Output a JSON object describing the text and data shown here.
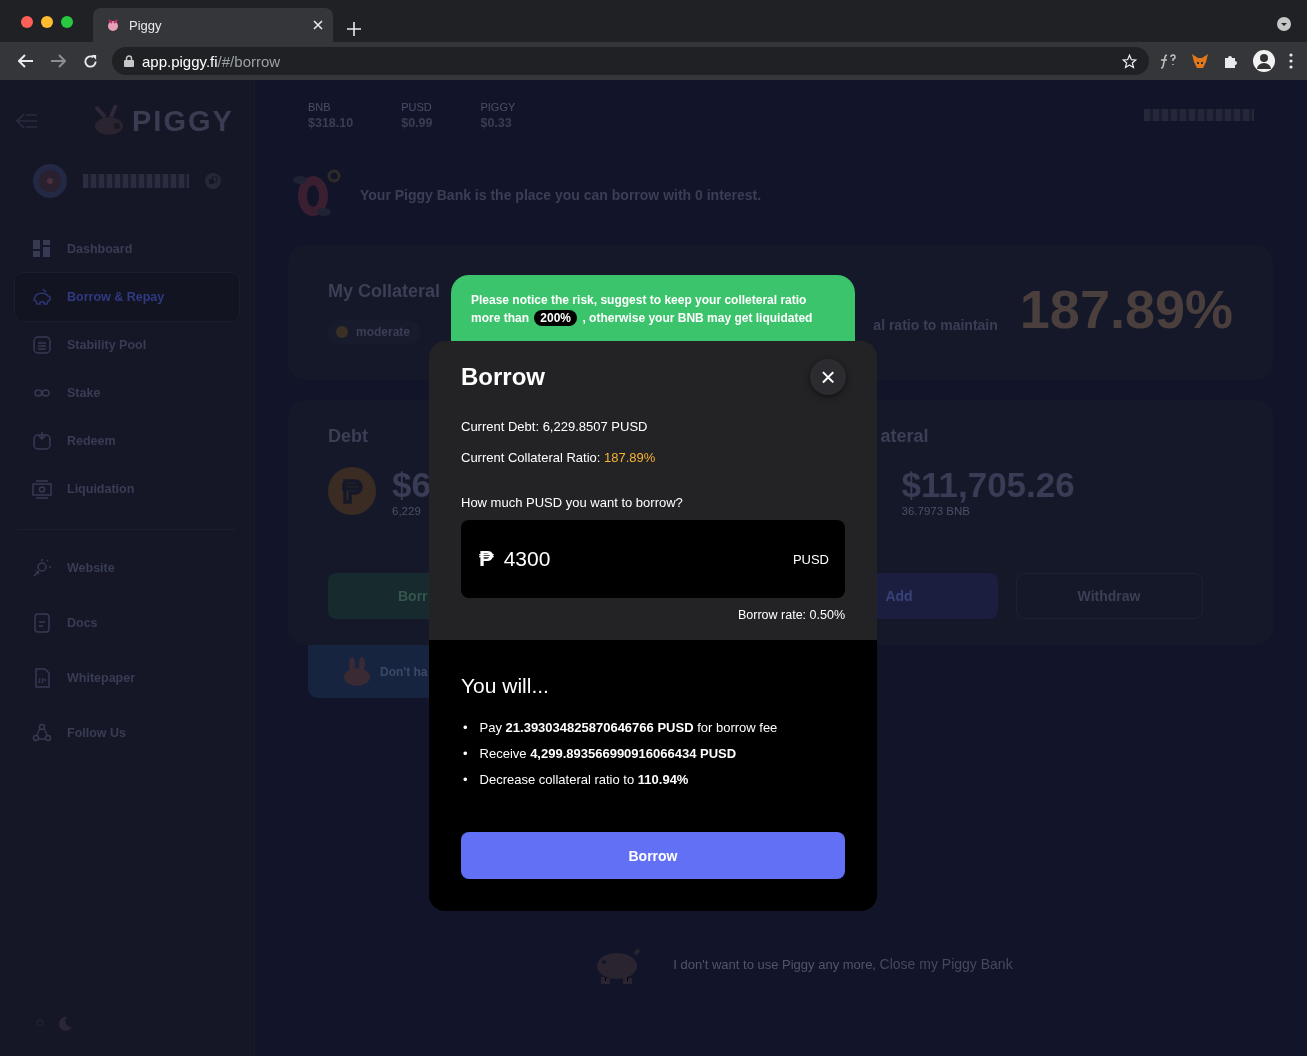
{
  "browser": {
    "tab_title": "Piggy",
    "url_host": "app.piggy.fi",
    "url_path": "/#/borrow"
  },
  "sidebar": {
    "logo": "PIGGY",
    "items": [
      {
        "label": "Dashboard",
        "selected": false,
        "kind": "dashboard"
      },
      {
        "label": "Borrow & Repay",
        "selected": true,
        "kind": "piggy"
      },
      {
        "label": "Stability Pool",
        "selected": false,
        "kind": "pool"
      },
      {
        "label": "Stake",
        "selected": false,
        "kind": "stake"
      },
      {
        "label": "Redeem",
        "selected": false,
        "kind": "redeem"
      },
      {
        "label": "Liquidation",
        "selected": false,
        "kind": "cash"
      }
    ],
    "links": [
      {
        "label": "Website",
        "selected": false,
        "kind": "web"
      },
      {
        "label": "Docs",
        "selected": false,
        "kind": "doc"
      },
      {
        "label": "Whitepaper",
        "selected": false,
        "kind": "paper"
      },
      {
        "label": "Follow Us",
        "selected": false,
        "kind": "follow"
      }
    ]
  },
  "prices": [
    {
      "symbol": "BNB",
      "price": "$318.10"
    },
    {
      "symbol": "PUSD",
      "price": "$0.99"
    },
    {
      "symbol": "PIGGY",
      "price": "$0.33"
    }
  ],
  "intro": "Your Piggy Bank is the place you can borrow with 0 interest.",
  "ratio_card": {
    "title": "My Collateral",
    "risk": "moderate",
    "note": "al ratio to maintain",
    "ratio": "187.89%"
  },
  "debt_card": {
    "title": "Debt",
    "amount": "$6",
    "sub": "6,229",
    "button": "Borr"
  },
  "collateral_card": {
    "title": "ateral",
    "amount": "$11,705.26",
    "sub": "36.7973 BNB",
    "buttons": [
      {
        "label": "Add",
        "kind": "primary"
      },
      {
        "label": "Withdraw",
        "kind": "outline"
      }
    ]
  },
  "promo": "Don't ha",
  "footer": {
    "text": "I don't want to use Piggy any more,",
    "link": "Close my Piggy Bank"
  },
  "modal": {
    "warning_before": "Please notice the risk, suggest to keep your colleteral ratio more than",
    "warning_badge": "200%",
    "warning_after": ", otherwise your BNB may get liquidated",
    "title": "Borrow",
    "close": "×",
    "debt_line": "Current Debt: 6,229.8507 PUSD",
    "ratio_label": "Current Collateral Ratio:",
    "ratio_value": "187.89%",
    "question": "How much PUSD you want to borrow?",
    "input_symbol": "₱",
    "input_value": "4300",
    "input_unit": "PUSD",
    "rate": "Borrow rate: 0.50%",
    "result_title": "You will...",
    "results": [
      {
        "bullet": "•",
        "text": "Pay **21.393034825870646766 PUSD** for borrow fee"
      },
      {
        "bullet": "•",
        "text": "Receive **4,299.893566990916066434 PUSD**"
      },
      {
        "bullet": "•",
        "text": "Decrease collateral ratio to **110.94%**"
      }
    ],
    "button": "Borrow"
  }
}
